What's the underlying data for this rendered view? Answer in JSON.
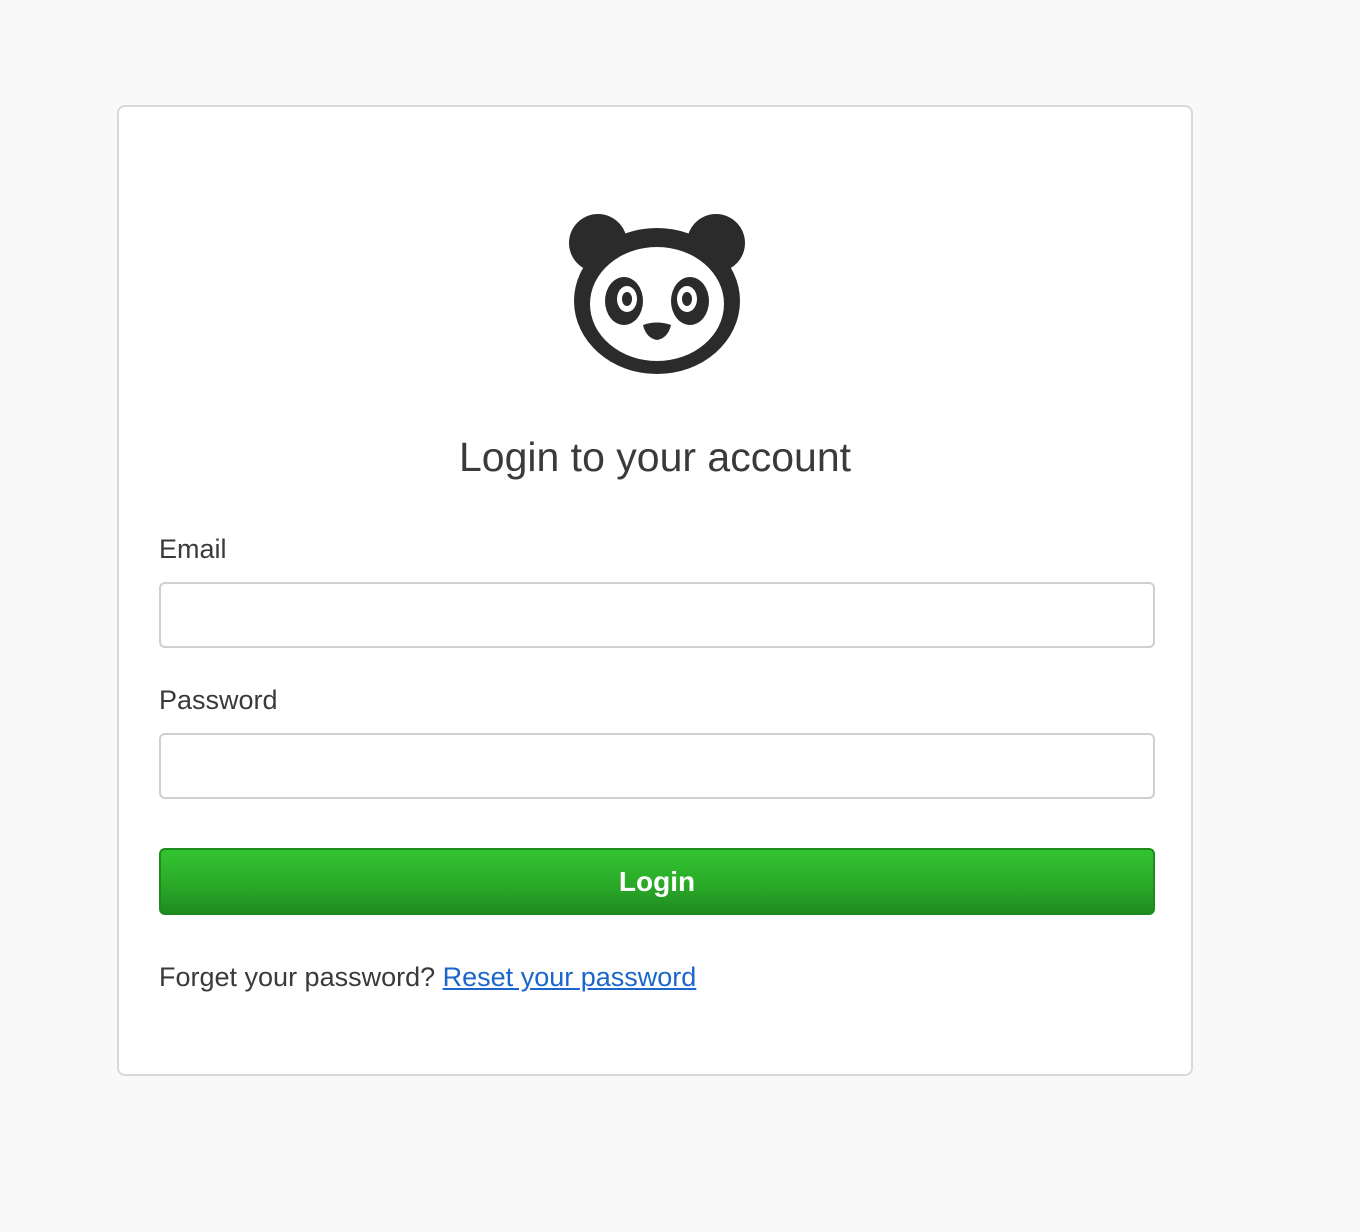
{
  "logo": {
    "icon": "panda-icon"
  },
  "form": {
    "title": "Login to your account",
    "email_label": "Email",
    "email_value": "",
    "password_label": "Password",
    "password_value": "",
    "submit_label": "Login",
    "forgot_text": "Forget your password?",
    "reset_link_label": "Reset your password"
  },
  "colors": {
    "page_background": "#f9f9f9",
    "card_background": "#ffffff",
    "button_green": "#2aaa28",
    "link_blue": "#1a66cc",
    "text": "#3a3a3a"
  }
}
